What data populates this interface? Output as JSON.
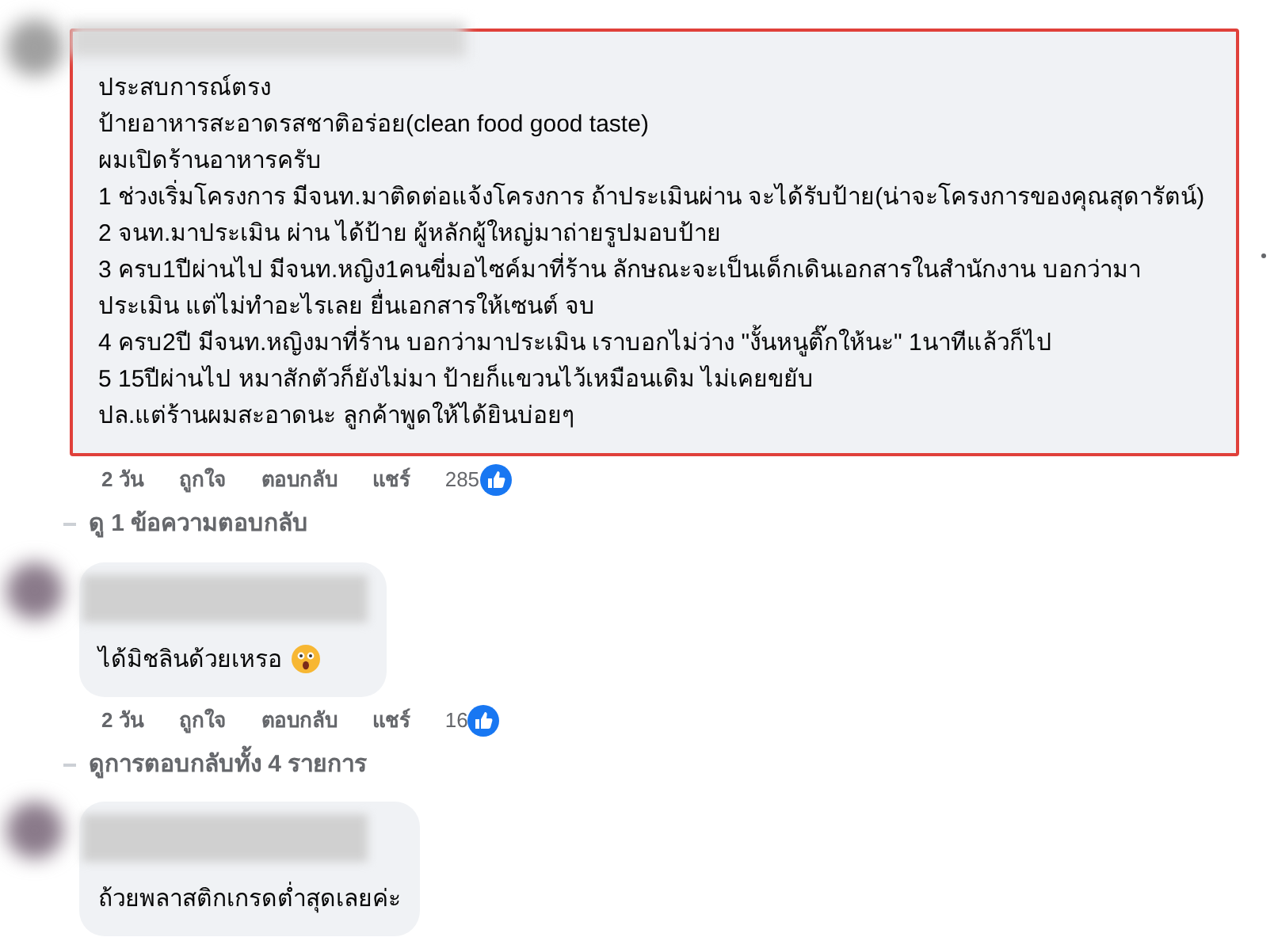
{
  "comments": [
    {
      "highlighted": true,
      "lines": [
        "ประสบการณ์ตรง",
        "ป้ายอาหารสะอาดรสชาติอร่อย(clean food good taste)",
        "ผมเปิดร้านอาหารครับ",
        "1 ช่วงเริ่มโครงการ มีจนท.มาติดต่อแจ้งโครงการ ถ้าประเมินผ่าน จะได้รับป้าย(น่าจะโครงการของคุณสุดารัตน์)",
        "2 จนท.มาประเมิน ผ่าน ได้ป้าย ผู้หลักผู้ใหญ่มาถ่ายรูปมอบป้าย",
        "3 ครบ1ปีผ่านไป มีจนท.หญิง1คนขี่มอไซค์มาที่ร้าน ลักษณะจะเป็นเด็กเดินเอกสารในสำนักงาน บอกว่ามาประเมิน แต่ไม่ทำอะไรเลย ยื่นเอกสารให้เซนต์ จบ",
        "4 ครบ2ปี มีจนท.หญิงมาที่ร้าน บอกว่ามาประเมิน เราบอกไม่ว่าง \"งั้นหนูติ๊กให้นะ\" 1นาทีแล้วก็ไป",
        "5 15ปีผ่านไป หมาสักตัวก็ยังไม่มา ป้ายก็แขวนไว้เหมือนเดิม ไม่เคยขยับ",
        "ปล.แต่ร้านผมสะอาดนะ ลูกค้าพูดให้ได้ยินบ่อยๆ"
      ],
      "time": "2 วัน",
      "actions": [
        "ถูกใจ",
        "ตอบกลับ",
        "แชร์"
      ],
      "likes": "285",
      "replies_link": "ดู 1 ข้อความตอบกลับ"
    },
    {
      "highlighted": false,
      "lines": [
        "ได้มิชลินด้วยเหรอ"
      ],
      "emoji": true,
      "time": "2 วัน",
      "actions": [
        "ถูกใจ",
        "ตอบกลับ",
        "แชร์"
      ],
      "likes": "16",
      "replies_link": "ดูการตอบกลับทั้ง 4 รายการ"
    },
    {
      "highlighted": false,
      "lines": [
        "ถ้วยพลาสติกเกรดต่ำสุดเลยค่ะ"
      ]
    }
  ]
}
